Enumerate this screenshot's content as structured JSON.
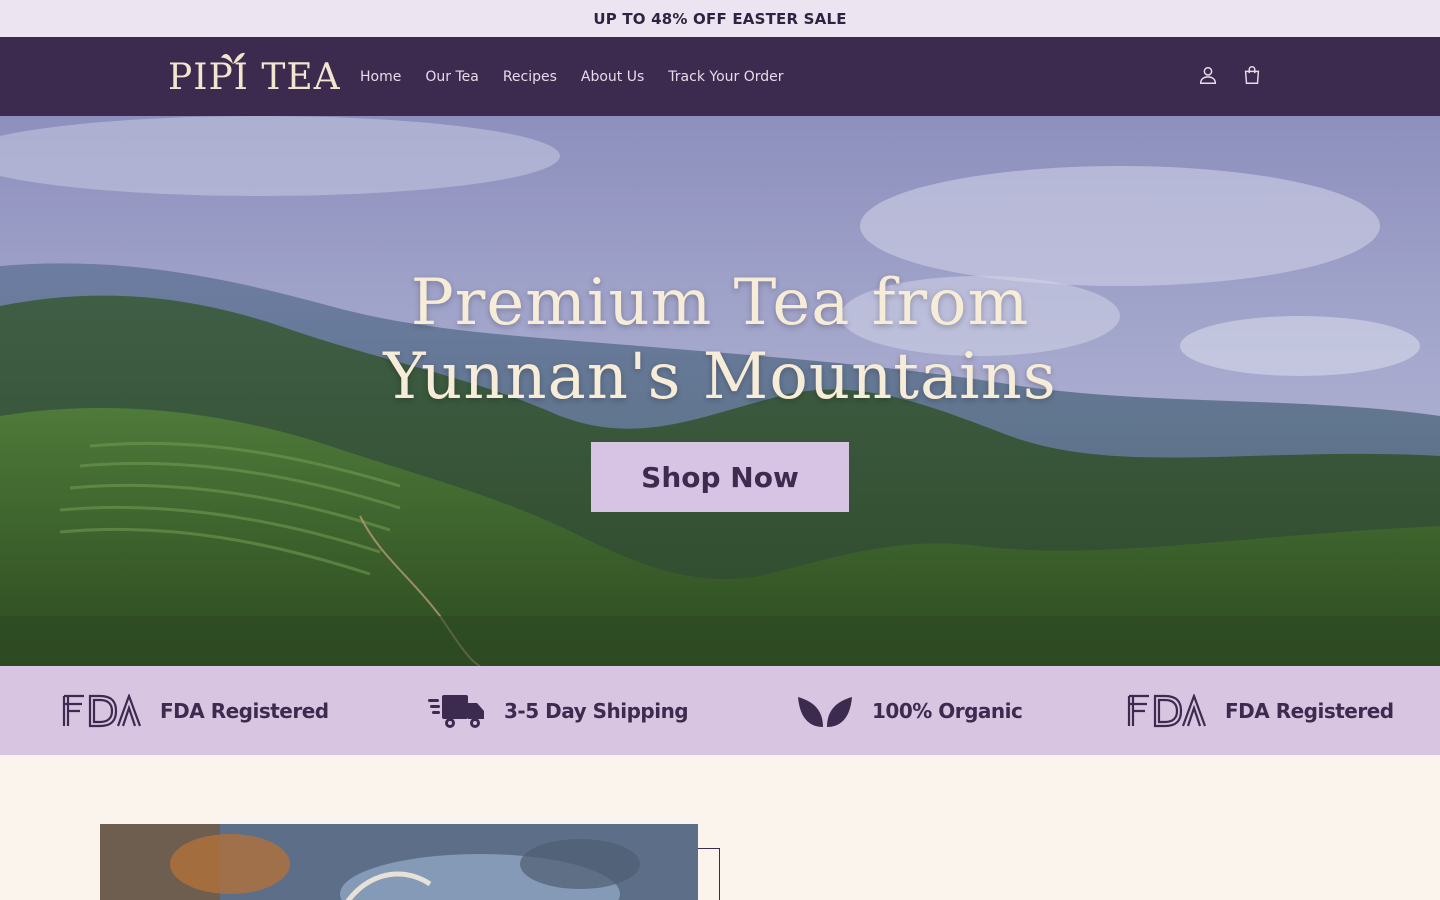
{
  "announcement": {
    "text": "UP TO 48% OFF EASTER SALE"
  },
  "brand": {
    "logo_text": "PIPI TEA"
  },
  "nav": {
    "items": [
      {
        "label": "Home"
      },
      {
        "label": "Our Tea"
      },
      {
        "label": "Recipes"
      },
      {
        "label": "About Us"
      },
      {
        "label": "Track Your Order"
      }
    ]
  },
  "header_icons": {
    "account": "account-icon",
    "cart": "cart-icon"
  },
  "hero": {
    "title_line1": "Premium Tea from",
    "title_line2": "Yunnan's Mountains",
    "cta_label": "Shop Now"
  },
  "features": [
    {
      "icon": "fda-icon",
      "label": "FDA Registered"
    },
    {
      "icon": "delivery-truck-icon",
      "label": "3-5 Day Shipping"
    },
    {
      "icon": "leaves-icon",
      "label": "100% Organic"
    },
    {
      "icon": "fda-icon",
      "label": "FDA Registered"
    }
  ],
  "colors": {
    "header_bg": "#3d2a4f",
    "announcement_bg": "#ede4f1",
    "feature_bar_bg": "#d8c5e2",
    "cta_bg": "#d7c3e3",
    "page_bg": "#faf4ec"
  }
}
